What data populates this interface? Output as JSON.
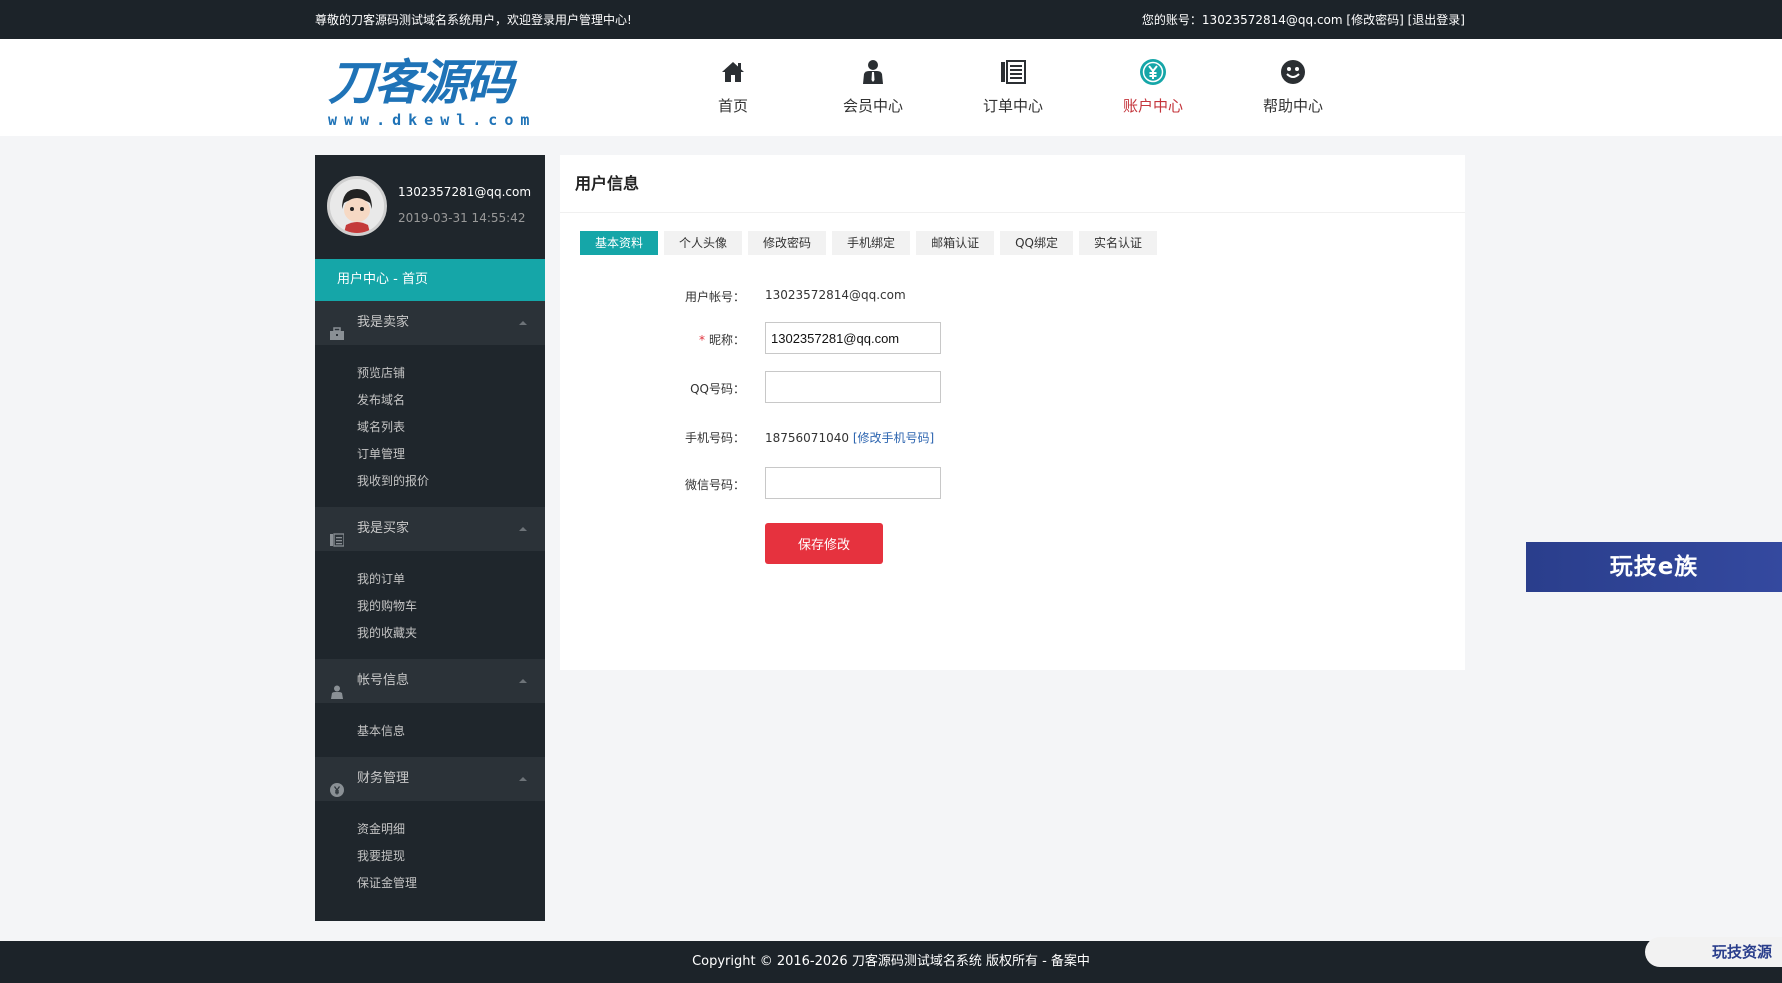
{
  "topbar": {
    "welcome": "尊敬的刀客源码测试域名系统用户，欢迎登录用户管理中心!",
    "account_prefix": "您的账号：",
    "account": "13023572814@qq.com",
    "change_password": "[修改密码]",
    "logout": "[退出登录]"
  },
  "logo": {
    "main": "刀客源码",
    "sub": "www.dkewl.com"
  },
  "nav": [
    {
      "label": "首页",
      "icon": "home-icon"
    },
    {
      "label": "会员中心",
      "icon": "member-icon"
    },
    {
      "label": "订单中心",
      "icon": "order-icon"
    },
    {
      "label": "账户中心",
      "icon": "yen-icon",
      "active": true
    },
    {
      "label": "帮助中心",
      "icon": "smiley-icon"
    }
  ],
  "sidebar": {
    "user_name": "1302357281@qq.com",
    "user_time": "2019-03-31 14:55:42",
    "home_link": "用户中心 - 首页",
    "groups": [
      {
        "title": "我是卖家",
        "icon": "briefcase-icon",
        "items": [
          "预览店铺",
          "发布域名",
          "域名列表",
          "订单管理",
          "我收到的报价"
        ]
      },
      {
        "title": "我是买家",
        "icon": "list-icon",
        "items": [
          "我的订单",
          "我的购物车",
          "我的收藏夹"
        ]
      },
      {
        "title": "帐号信息",
        "icon": "user-icon",
        "items": [
          "基本信息"
        ]
      },
      {
        "title": "财务管理",
        "icon": "yen-icon",
        "items": [
          "资金明细",
          "我要提现",
          "保证金管理"
        ]
      }
    ]
  },
  "main": {
    "title": "用户信息",
    "tabs": [
      "基本资料",
      "个人头像",
      "修改密码",
      "手机绑定",
      "邮箱认证",
      "QQ绑定",
      "实名认证"
    ],
    "fields": {
      "account_label": "用户帐号：",
      "account_value": "13023572814@qq.com",
      "nickname_label": "昵称：",
      "nickname_value": "1302357281@qq.com",
      "qq_label": "QQ号码：",
      "qq_value": "",
      "phone_label": "手机号码：",
      "phone_value": "18756071040",
      "phone_change": "[修改手机号码]",
      "wechat_label": "微信号码：",
      "wechat_value": ""
    },
    "save_button": "保存修改"
  },
  "float_ad": "玩技e族",
  "corner_badge": "玩技资源",
  "footer": "Copyright © 2016-2026 刀客源码测试域名系统 版权所有 - 备案中",
  "colors": {
    "accent": "#15a6a8",
    "danger": "#e6323e",
    "dark": "#1c2329",
    "active_nav": "#c4343b"
  }
}
